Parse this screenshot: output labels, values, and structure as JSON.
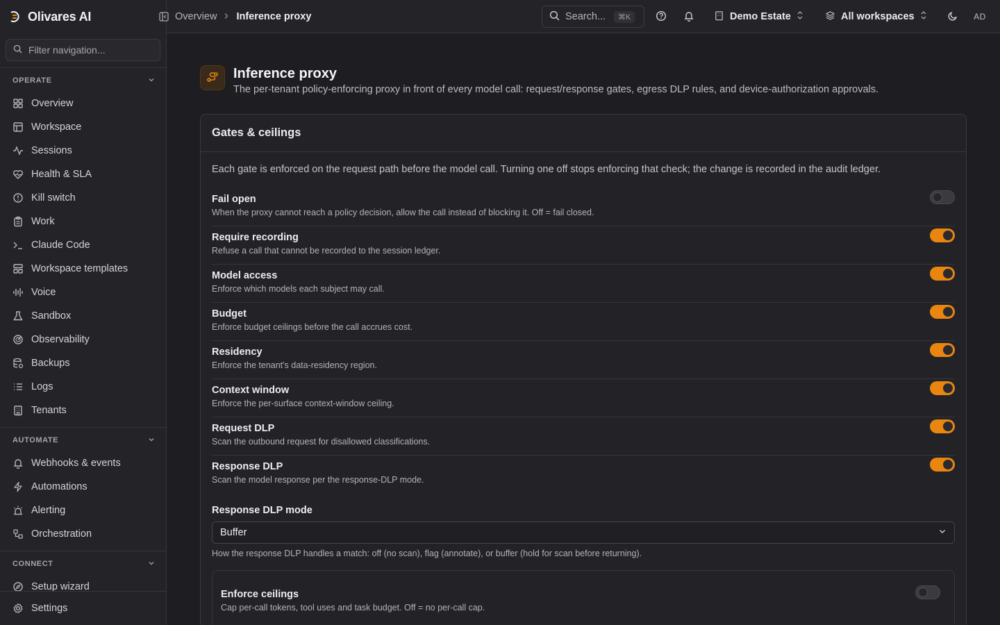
{
  "brand": {
    "name": "Olivares AI",
    "accent": "#e8860f"
  },
  "sidebar": {
    "filter_placeholder": "Filter navigation...",
    "groups": [
      {
        "label": "OPERATE"
      },
      {
        "label": "AUTOMATE"
      },
      {
        "label": "CONNECT"
      }
    ],
    "operate": [
      {
        "label": "Overview",
        "icon": "dashboard-icon"
      },
      {
        "label": "Workspace",
        "icon": "layout-icon"
      },
      {
        "label": "Sessions",
        "icon": "activity-icon"
      },
      {
        "label": "Health & SLA",
        "icon": "heart-pulse-icon"
      },
      {
        "label": "Kill switch",
        "icon": "alert-circle-icon"
      },
      {
        "label": "Work",
        "icon": "clipboard-icon"
      },
      {
        "label": "Claude Code",
        "icon": "terminal-icon"
      },
      {
        "label": "Workspace templates",
        "icon": "templates-icon"
      },
      {
        "label": "Voice",
        "icon": "audio-lines-icon"
      },
      {
        "label": "Sandbox",
        "icon": "flask-icon"
      },
      {
        "label": "Observability",
        "icon": "radar-icon"
      },
      {
        "label": "Backups",
        "icon": "database-backup-icon"
      },
      {
        "label": "Logs",
        "icon": "list-icon"
      },
      {
        "label": "Tenants",
        "icon": "building-icon"
      }
    ],
    "automate": [
      {
        "label": "Webhooks & events",
        "icon": "bell-icon"
      },
      {
        "label": "Automations",
        "icon": "zap-icon"
      },
      {
        "label": "Alerting",
        "icon": "siren-icon"
      },
      {
        "label": "Orchestration",
        "icon": "workflow-icon"
      }
    ],
    "connect": [
      {
        "label": "Setup wizard",
        "icon": "compass-icon"
      }
    ],
    "footer": {
      "label": "Settings",
      "icon": "gear-icon"
    }
  },
  "topbar": {
    "breadcrumb": {
      "parent": "Overview",
      "separator": ">",
      "current": "Inference proxy"
    },
    "search": {
      "placeholder": "Search...",
      "shortcut": "⌘K"
    },
    "tenant": "Demo Estate",
    "workspace": "All workspaces",
    "avatar_initials": "AD"
  },
  "page": {
    "title": "Inference proxy",
    "subtitle": "The per-tenant policy-enforcing proxy in front of every model call: request/response gates, egress DLP rules, and device-authorization approvals."
  },
  "gates_card": {
    "title": "Gates & ceilings",
    "intro": "Each gate is enforced on the request path before the model call. Turning one off stops enforcing that check; the change is recorded in the audit ledger.",
    "gates": [
      {
        "label": "Fail open",
        "desc": "When the proxy cannot reach a policy decision, allow the call instead of blocking it. Off = fail closed.",
        "enabled": false
      },
      {
        "label": "Require recording",
        "desc": "Refuse a call that cannot be recorded to the session ledger.",
        "enabled": true
      },
      {
        "label": "Model access",
        "desc": "Enforce which models each subject may call.",
        "enabled": true
      },
      {
        "label": "Budget",
        "desc": "Enforce budget ceilings before the call accrues cost.",
        "enabled": true
      },
      {
        "label": "Residency",
        "desc": "Enforce the tenant's data-residency region.",
        "enabled": true
      },
      {
        "label": "Context window",
        "desc": "Enforce the per-surface context-window ceiling.",
        "enabled": true
      },
      {
        "label": "Request DLP",
        "desc": "Scan the outbound request for disallowed classifications.",
        "enabled": true
      },
      {
        "label": "Response DLP",
        "desc": "Scan the model response per the response-DLP mode.",
        "enabled": true
      }
    ],
    "dlp_mode": {
      "label": "Response DLP mode",
      "value": "Buffer",
      "help": "How the response DLP handles a match: off (no scan), flag (annotate), or buffer (hold for scan before returning)."
    },
    "ceilings": {
      "label": "Enforce ceilings",
      "desc": "Cap per-call tokens, tool uses and task budget. Off = no per-call cap.",
      "enabled": false
    }
  }
}
